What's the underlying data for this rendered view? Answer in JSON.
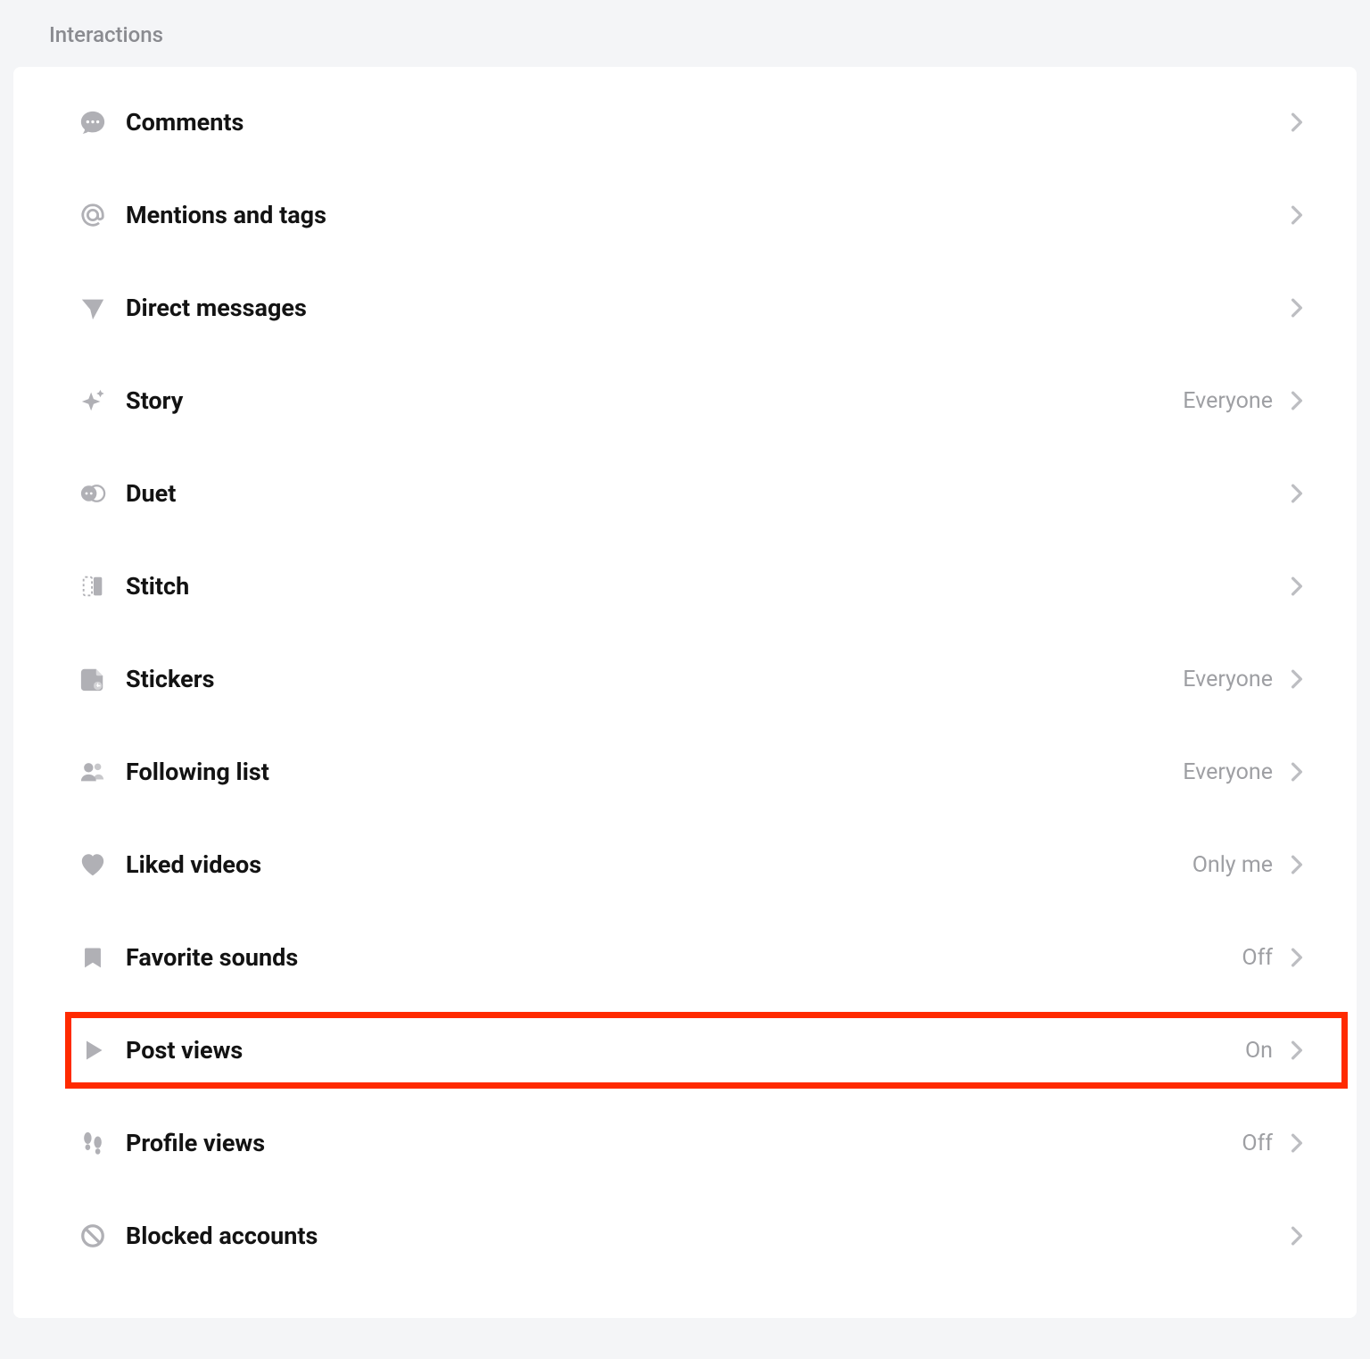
{
  "section": {
    "title": "Interactions"
  },
  "items": [
    {
      "id": "comments",
      "icon": "comment-bubble-icon",
      "label": "Comments",
      "value": "",
      "highlight": false
    },
    {
      "id": "mentions",
      "icon": "at-sign-icon",
      "label": "Mentions and tags",
      "value": "",
      "highlight": false
    },
    {
      "id": "direct-msgs",
      "icon": "paper-plane-icon",
      "label": "Direct messages",
      "value": "",
      "highlight": false
    },
    {
      "id": "story",
      "icon": "sparkle-icon",
      "label": "Story",
      "value": "Everyone",
      "highlight": false
    },
    {
      "id": "duet",
      "icon": "duet-icon",
      "label": "Duet",
      "value": "",
      "highlight": false
    },
    {
      "id": "stitch",
      "icon": "stitch-icon",
      "label": "Stitch",
      "value": "",
      "highlight": false
    },
    {
      "id": "stickers",
      "icon": "sticker-icon",
      "label": "Stickers",
      "value": "Everyone",
      "highlight": false
    },
    {
      "id": "following-list",
      "icon": "people-icon",
      "label": "Following list",
      "value": "Everyone",
      "highlight": false
    },
    {
      "id": "liked-videos",
      "icon": "heart-icon",
      "label": "Liked videos",
      "value": "Only me",
      "highlight": false
    },
    {
      "id": "favorite-sounds",
      "icon": "bookmark-icon",
      "label": "Favorite sounds",
      "value": "Off",
      "highlight": false
    },
    {
      "id": "post-views",
      "icon": "play-triangle-icon",
      "label": "Post views",
      "value": "On",
      "highlight": true
    },
    {
      "id": "profile-views",
      "icon": "footprints-icon",
      "label": "Profile views",
      "value": "Off",
      "highlight": false
    },
    {
      "id": "blocked",
      "icon": "block-icon",
      "label": "Blocked accounts",
      "value": "",
      "highlight": false
    }
  ]
}
